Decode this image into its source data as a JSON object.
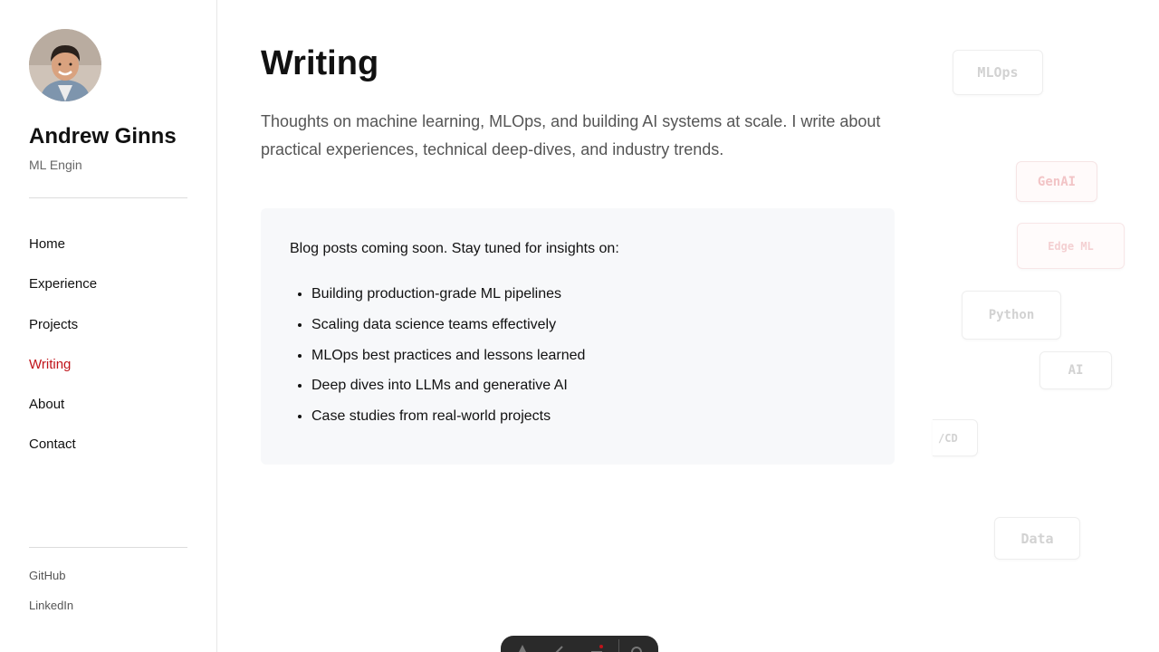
{
  "profile": {
    "name": "Andrew Ginns",
    "role": "ML Engin"
  },
  "nav": {
    "items": [
      {
        "label": "Home"
      },
      {
        "label": "Experience"
      },
      {
        "label": "Projects"
      },
      {
        "label": "Writing",
        "active": true
      },
      {
        "label": "About"
      },
      {
        "label": "Contact"
      }
    ]
  },
  "social": {
    "github": "GitHub",
    "linkedin": "LinkedIn"
  },
  "page": {
    "title": "Writing",
    "intro": "Thoughts on machine learning, MLOps, and building AI systems at scale. I write about practical experiences, technical deep-dives, and industry trends."
  },
  "card": {
    "lead": "Blog posts coming soon. Stay tuned for insights on:",
    "items": [
      "Building production-grade ML pipelines",
      "Scaling data science teams effectively",
      "MLOps best practices and lessons learned",
      "Deep dives into LLMs and generative AI",
      "Case studies from real-world projects"
    ]
  },
  "tags": {
    "mlops": "MLOps",
    "genai": "GenAI",
    "edge_ml": "Edge ML",
    "python": "Python",
    "ai": "AI",
    "cicd": "/CD",
    "data": "Data"
  },
  "colors": {
    "accent": "#c0141a",
    "text": "#111111",
    "muted": "#555555",
    "card_bg": "#f7f8fa"
  }
}
